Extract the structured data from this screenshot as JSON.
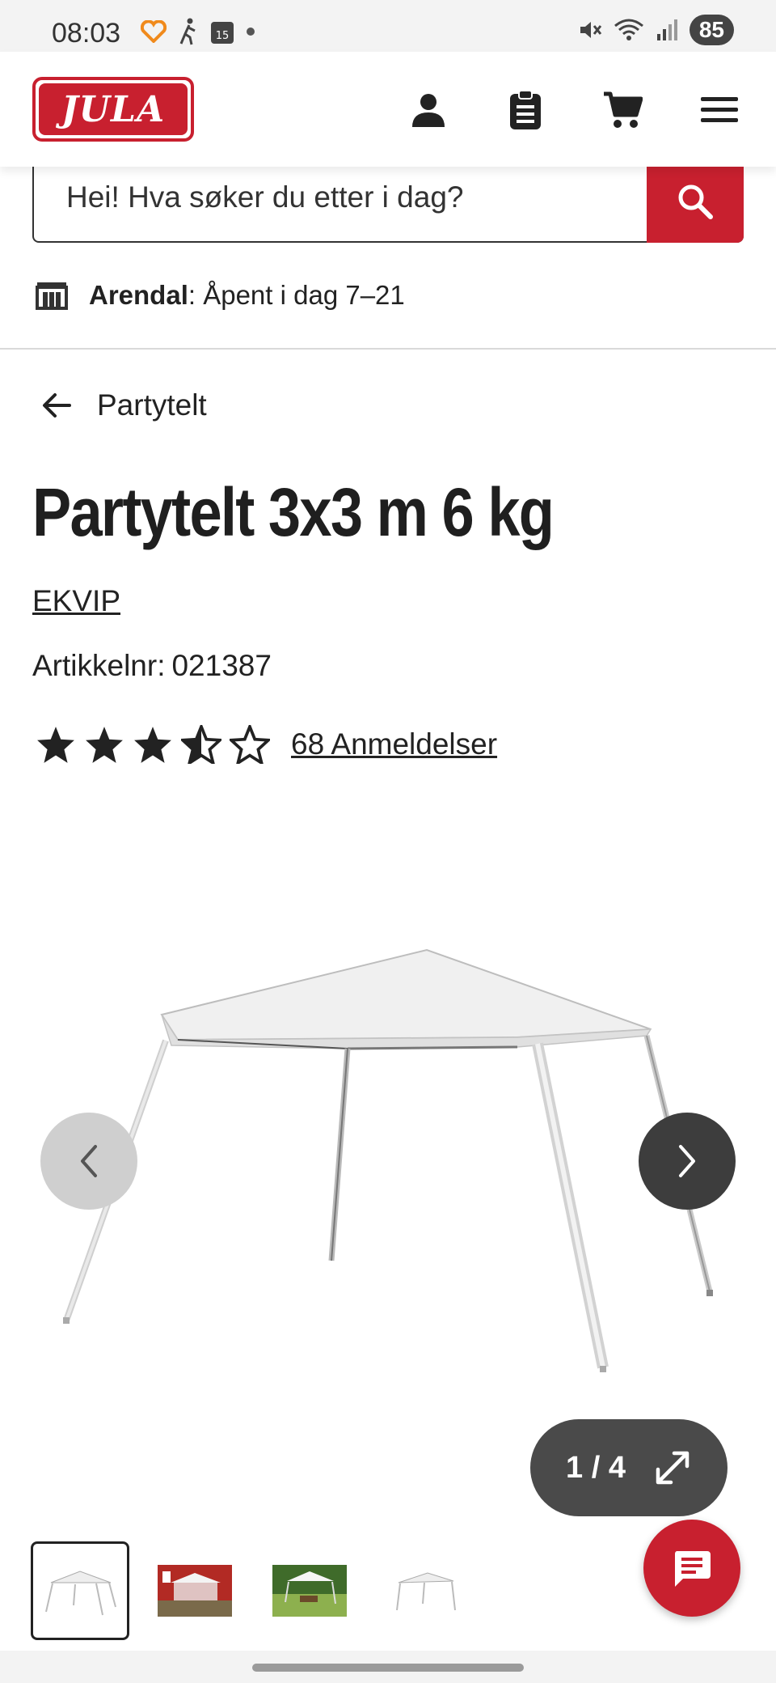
{
  "status_bar": {
    "time": "08:03",
    "calendar_day": "15",
    "battery": "85"
  },
  "header": {
    "logo_text": "JULA",
    "icons": [
      "account-icon",
      "shopping-list-icon",
      "cart-icon",
      "menu-icon"
    ]
  },
  "search": {
    "placeholder": "Hei! Hva søker du etter i dag?"
  },
  "store": {
    "name": "Arendal",
    "hours": ": Åpent i dag 7–21"
  },
  "breadcrumb": {
    "label": "Partytelt"
  },
  "product": {
    "title": "Partytelt 3x3 m 6 kg",
    "brand": "EKVIP",
    "sku_label": "Artikkelnr:",
    "sku_value": "021387",
    "rating": 3.5,
    "rating_max": 5,
    "reviews_label": "68 Anmeldelser"
  },
  "gallery": {
    "counter": "1 / 4",
    "thumbnails": [
      "white-tent",
      "red-house-tent",
      "garden-tent",
      "white-tent-small"
    ]
  },
  "colors": {
    "brand_red": "#c8202f",
    "text_dark": "#222222",
    "nav_dark": "#3d3d3d"
  }
}
